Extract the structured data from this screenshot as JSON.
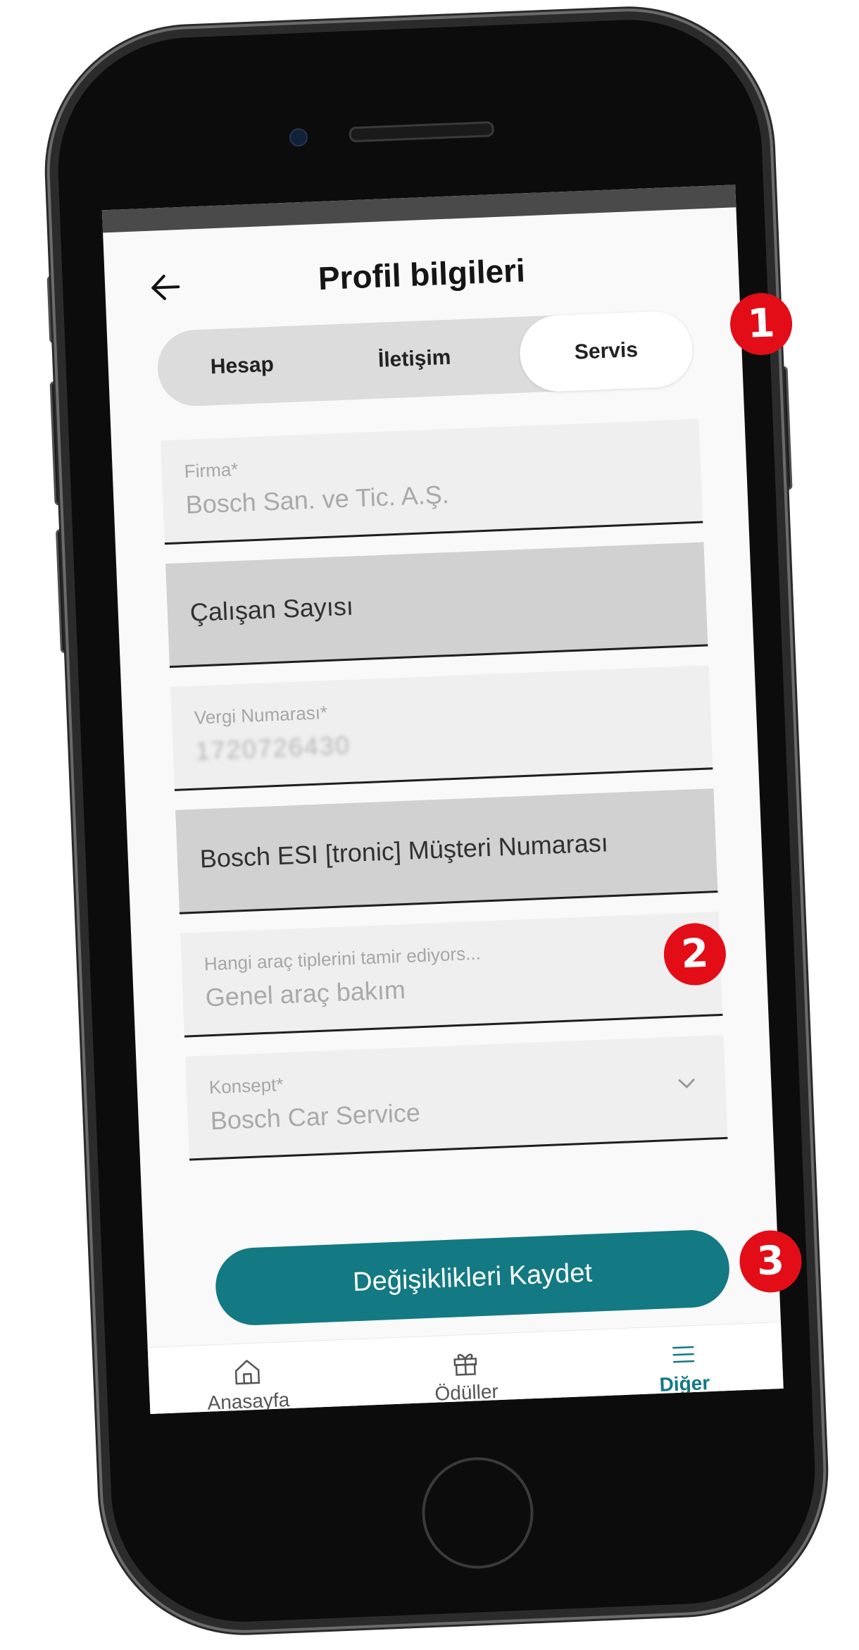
{
  "header": {
    "title": "Profil bilgileri"
  },
  "tabs": [
    {
      "label": "Hesap"
    },
    {
      "label": "İletişim"
    },
    {
      "label": "Servis",
      "active": true
    }
  ],
  "form": {
    "firma": {
      "label": "Firma*",
      "value": "Bosch San. ve Tic. A.Ş."
    },
    "calisan_sayisi": {
      "placeholder": "Çalışan Sayısı"
    },
    "vergi": {
      "label": "Vergi Numarası*",
      "value": "1720726430"
    },
    "esi": {
      "placeholder": "Bosch ESI [tronic] Müşteri Numarası"
    },
    "arac_tipleri": {
      "label": "Hangi araç tiplerini tamir ediyors...",
      "value": "Genel araç  bakım"
    },
    "konsept": {
      "label": "Konsept*",
      "value": "Bosch Car Service"
    }
  },
  "save_button": {
    "label": "Değişiklikleri Kaydet"
  },
  "bottom_nav": [
    {
      "label": "Anasayfa",
      "icon": "home-icon"
    },
    {
      "label": "Ödüller",
      "icon": "gift-icon"
    },
    {
      "label": "Diğer",
      "icon": "menu-icon",
      "active": true
    }
  ],
  "badges": [
    "1",
    "2",
    "3"
  ],
  "colors": {
    "accent": "#137983",
    "badge": "#e20d17"
  }
}
